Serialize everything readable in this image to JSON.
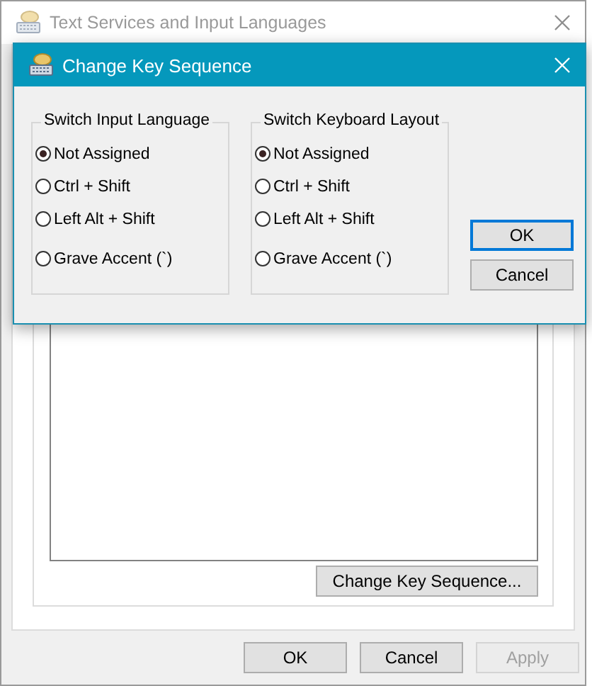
{
  "background_window": {
    "title": "Text Services and Input Languages",
    "change_key_button": "Change Key Sequence...",
    "buttons": [
      {
        "label": "OK",
        "disabled": false
      },
      {
        "label": "Cancel",
        "disabled": false
      },
      {
        "label": "Apply",
        "disabled": true
      }
    ]
  },
  "dialog": {
    "title": "Change Key Sequence",
    "groups": [
      {
        "label": "Switch Input Language",
        "options": [
          {
            "label": "Not Assigned",
            "selected": true
          },
          {
            "label": "Ctrl + Shift",
            "selected": false
          },
          {
            "label": "Left Alt + Shift",
            "selected": false
          },
          {
            "label": "Grave Accent (`)",
            "selected": false
          }
        ]
      },
      {
        "label": "Switch Keyboard Layout",
        "options": [
          {
            "label": "Not Assigned",
            "selected": true
          },
          {
            "label": "Ctrl + Shift",
            "selected": false
          },
          {
            "label": "Left Alt + Shift",
            "selected": false
          },
          {
            "label": "Grave Accent (`)",
            "selected": false
          }
        ]
      }
    ],
    "buttons": [
      {
        "label": "OK",
        "default": true
      },
      {
        "label": "Cancel",
        "default": false
      }
    ]
  }
}
